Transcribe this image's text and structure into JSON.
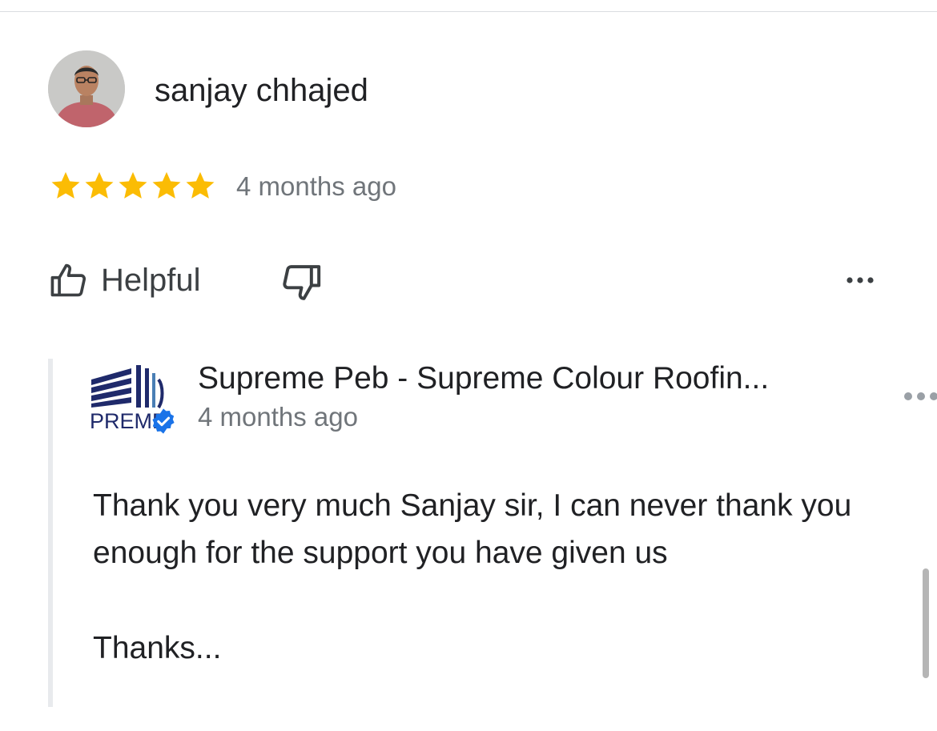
{
  "review": {
    "reviewer_name": "sanjay chhajed",
    "rating": 5,
    "max_rating": 5,
    "time_ago": "4 months ago",
    "helpful_label": "Helpful"
  },
  "owner_reply": {
    "owner_name": "Supreme Peb - Supreme Colour Roofin...",
    "logo_text": "PREME",
    "time_ago": "4 months ago",
    "text": "Thank you very much Sanjay sir, I can never thank you enough for the support you have given us",
    "sign_off": "Thanks..."
  },
  "colors": {
    "star": "#fbbc04",
    "verified_badge": "#1a73e8",
    "logo_navy": "#1f2a6b",
    "muted_text": "#70757a"
  }
}
